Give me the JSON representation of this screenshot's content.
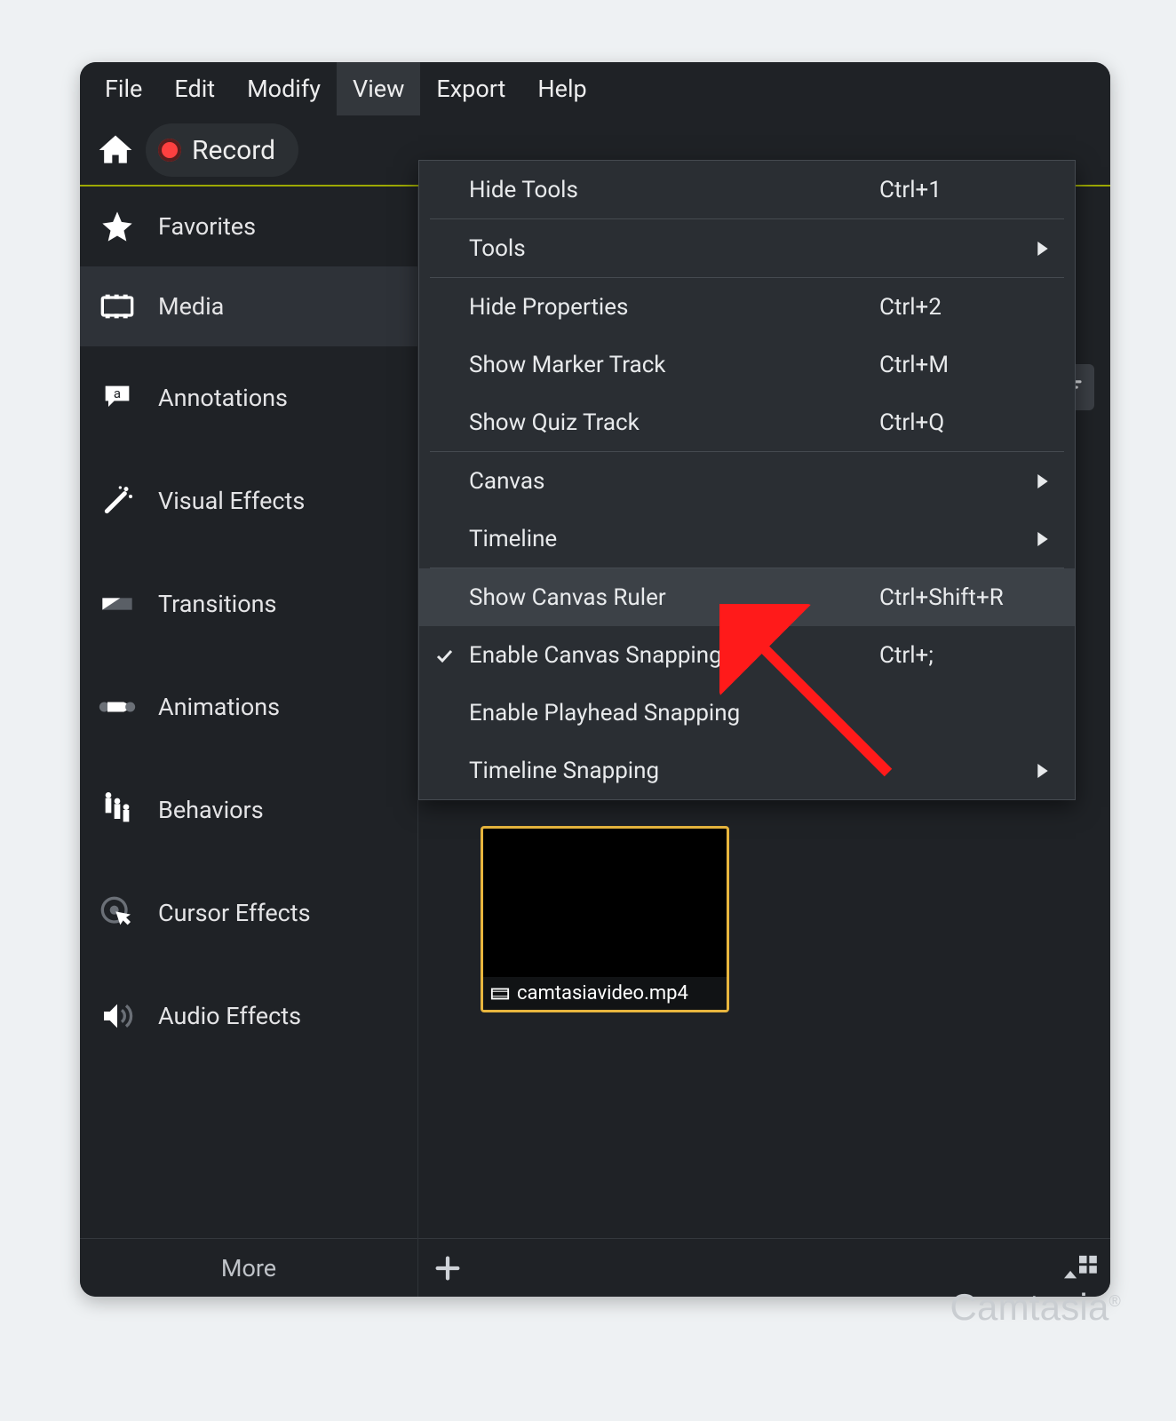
{
  "menubar": {
    "items": [
      "File",
      "Edit",
      "Modify",
      "View",
      "Export",
      "Help"
    ],
    "selected_index": 3
  },
  "toolbar": {
    "record_label": "Record"
  },
  "sidebar": {
    "items": [
      {
        "label": "Favorites",
        "icon": "star-icon"
      },
      {
        "label": "Media",
        "icon": "film-icon",
        "active": true
      },
      {
        "label": "Annotations",
        "icon": "annotation-icon"
      },
      {
        "label": "Visual Effects",
        "icon": "wand-icon"
      },
      {
        "label": "Transitions",
        "icon": "transition-icon"
      },
      {
        "label": "Animations",
        "icon": "animation-icon"
      },
      {
        "label": "Behaviors",
        "icon": "behaviors-icon"
      },
      {
        "label": "Cursor Effects",
        "icon": "cursor-icon"
      },
      {
        "label": "Audio Effects",
        "icon": "audio-icon"
      }
    ],
    "more_label": "More"
  },
  "view_menu": {
    "groups": [
      [
        {
          "label": "Hide Tools",
          "shortcut": "Ctrl+1"
        },
        {
          "label": "Tools",
          "submenu": true
        }
      ],
      [
        {
          "label": "Hide Properties",
          "shortcut": "Ctrl+2"
        },
        {
          "label": "Show Marker Track",
          "shortcut": "Ctrl+M"
        },
        {
          "label": "Show Quiz Track",
          "shortcut": "Ctrl+Q"
        }
      ],
      [
        {
          "label": "Canvas",
          "submenu": true
        },
        {
          "label": "Timeline",
          "submenu": true
        }
      ],
      [
        {
          "label": "Show Canvas Ruler",
          "shortcut": "Ctrl+Shift+R",
          "hover": true
        },
        {
          "label": "Enable Canvas Snapping",
          "shortcut": "Ctrl+;",
          "checked": true
        },
        {
          "label": "Enable Playhead Snapping"
        },
        {
          "label": "Timeline Snapping",
          "submenu": true
        }
      ]
    ]
  },
  "media_bin": {
    "selected_file": "camtasiavideo.mp4"
  },
  "watermark": "Camtasia"
}
